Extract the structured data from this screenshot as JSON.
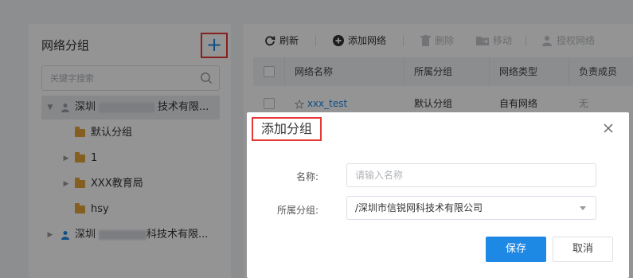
{
  "left_panel": {
    "title": "网络分组",
    "add_label": "+",
    "search_placeholder": "关键字搜索",
    "tree": [
      {
        "prefix": "深圳",
        "suffix": "技术有限...",
        "expanded": true
      },
      {
        "label": "默认分组"
      },
      {
        "label": "1"
      },
      {
        "label": "XXX教育局"
      },
      {
        "label": "hsy"
      },
      {
        "prefix": "深圳",
        "suffix": "科技术有限..."
      }
    ]
  },
  "toolbar": {
    "refresh": "刷新",
    "add_network": "添加网络",
    "delete": "删除",
    "move": "移动",
    "authorize": "授权网络"
  },
  "table": {
    "columns": [
      "网络名称",
      "所属分组",
      "网络类型",
      "负责成员"
    ],
    "rows": [
      {
        "name": "xxx_test",
        "group": "默认分组",
        "type": "自有网络",
        "owner": "无"
      }
    ]
  },
  "modal": {
    "title": "添加分组",
    "name_label": "名称:",
    "name_placeholder": "请输入名称",
    "group_label": "所属分组:",
    "group_value": "/深圳市信锐网科技术有限公司",
    "save": "保存",
    "cancel": "取消"
  },
  "colors": {
    "accent": "#1e88e5",
    "highlight_border": "#e53935",
    "folder": "#e6a23c"
  }
}
